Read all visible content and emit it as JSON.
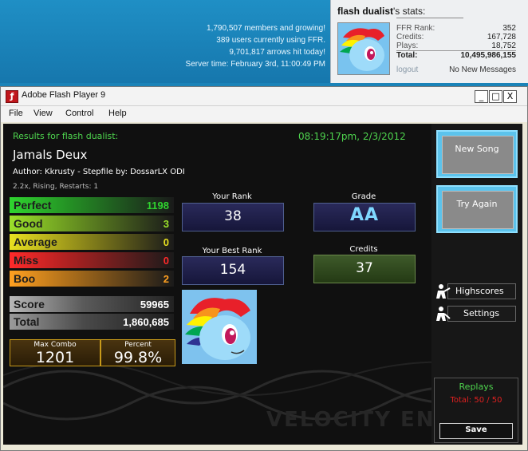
{
  "site": {
    "lines": [
      "1,790,507 members and growing!",
      "389 users currently using FFR.",
      "9,701,817 arrows hit today!",
      "Server time: February 3rd, 11:00:49 PM"
    ],
    "stats": {
      "username": "flash dualist",
      "title_suffix": "'s stats:",
      "rows": [
        {
          "label": "FFR Rank:",
          "value": "352"
        },
        {
          "label": "Credits:",
          "value": "167,728"
        },
        {
          "label": "Plays:",
          "value": "18,752"
        },
        {
          "label": "Total:",
          "value": "10,495,986,155"
        }
      ],
      "logout": "logout",
      "messages": "No New Messages"
    }
  },
  "window": {
    "title": "Adobe Flash Player 9",
    "buttons": {
      "minimize": "_",
      "maximize": "□",
      "close": "X"
    },
    "menu": [
      "File",
      "View",
      "Control",
      "Help"
    ]
  },
  "results": {
    "header": "Results for flash dualist:",
    "timestamp": "08:19:17pm, 2/3/2012",
    "song": "Jamals Deux",
    "author_line": "Author: Kkrusty  -  Stepfile by: DossarLX ODI",
    "options": "2.2x, Rising, Restarts: 1",
    "judgements": [
      {
        "label": "Perfect",
        "value": "1198",
        "color": "#2fd42f"
      },
      {
        "label": "Good",
        "value": "3",
        "color": "#9be02a"
      },
      {
        "label": "Average",
        "value": "0",
        "color": "#e8e020"
      },
      {
        "label": "Miss",
        "value": "0",
        "color": "#ff2a2a"
      },
      {
        "label": "Boo",
        "value": "2",
        "color": "#ffa020"
      }
    ],
    "score": {
      "label": "Score",
      "value": "59965"
    },
    "total": {
      "label": "Total",
      "value": "1,860,685"
    },
    "max_combo": {
      "label": "Max Combo",
      "value": "1201"
    },
    "percent": {
      "label": "Percent",
      "value": "99.8%"
    },
    "your_rank": {
      "label": "Your Rank",
      "value": "38"
    },
    "best_rank": {
      "label": "Your Best Rank",
      "value": "154"
    },
    "grade": {
      "label": "Grade",
      "value": "AA"
    },
    "credits": {
      "label": "Credits",
      "value": "37"
    },
    "watermark": "VELOCITY ENGINE"
  },
  "buttons": {
    "new_song": "New Song",
    "try_again": "Try Again",
    "highscores": "Highscores",
    "settings": "Settings"
  },
  "replays": {
    "title": "Replays",
    "count_line": "Total: 50 / 50",
    "save": "Save"
  }
}
